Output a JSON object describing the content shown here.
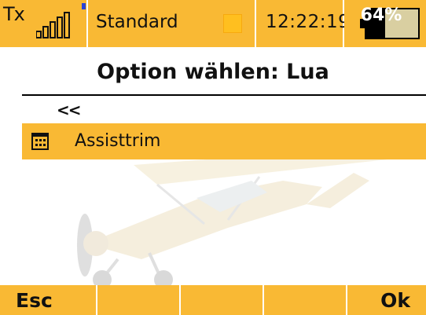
{
  "status_bar": {
    "tx_label": "Tx",
    "signal_icon": "signal-strength-icon",
    "model_name": "Standard",
    "model_indicator_color": "#ffbf1f",
    "time": "12:22:19",
    "battery_percent": "64%",
    "battery_level": 0.64
  },
  "page": {
    "title": "Option wählen: Lua"
  },
  "list": {
    "back_label": "<<",
    "items": [
      {
        "icon": "calendar-grid-icon",
        "label": "Assisttrim",
        "selected": true
      }
    ]
  },
  "softkeys": {
    "f1": "Esc",
    "f2": "",
    "f3": "",
    "f4": "",
    "f5": "Ok"
  },
  "colors": {
    "accent": "#f9b934",
    "text": "#111111",
    "battery_fill": "#d9cfa1",
    "tx_dot": "#2b43d8"
  }
}
